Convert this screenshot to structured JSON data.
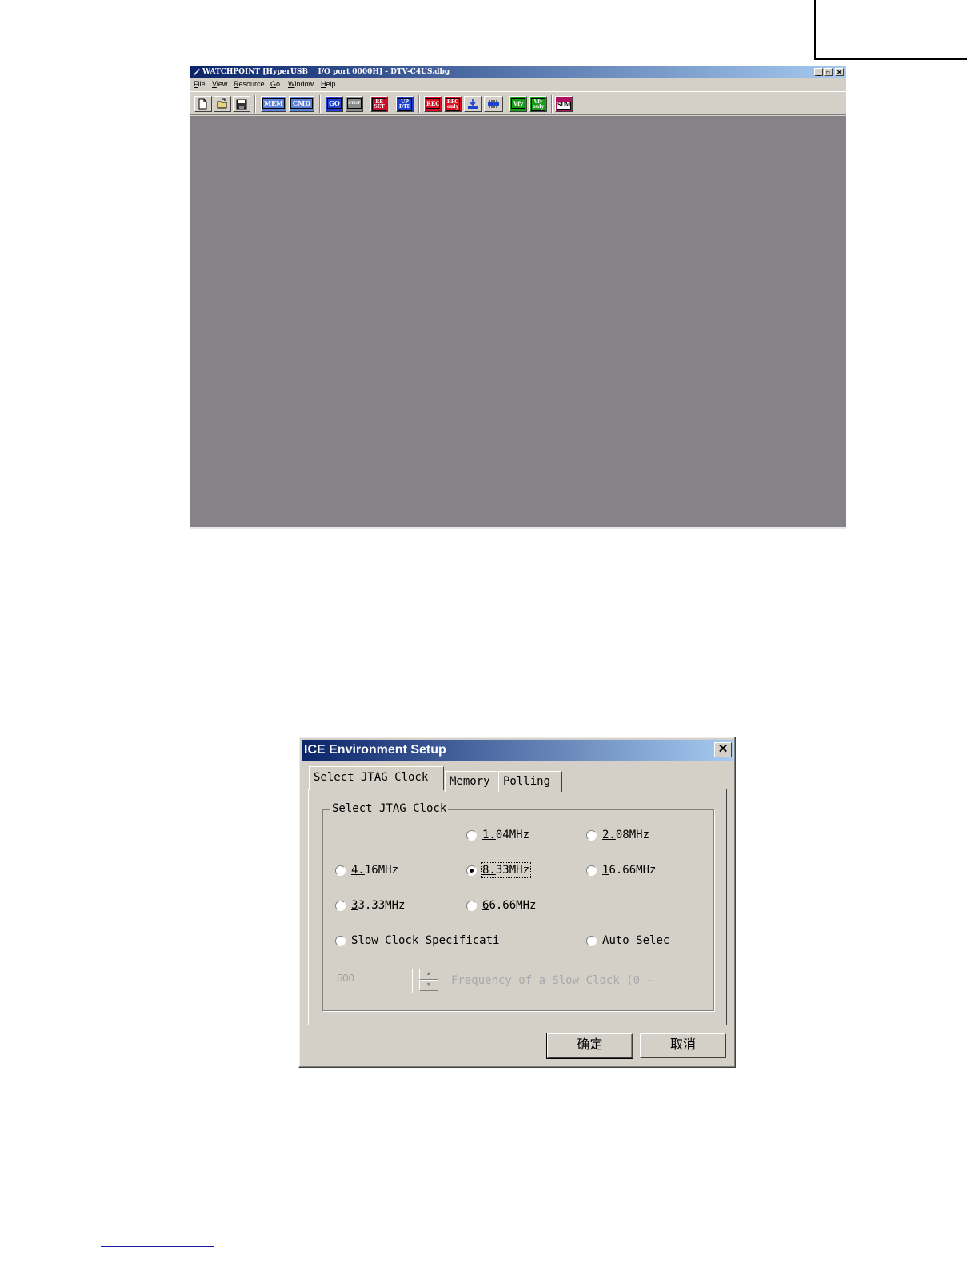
{
  "app": {
    "title": "WATCHPOINT [HyperUSB    I/O port 0000H] - DTV-C4US.dbg",
    "window_buttons": {
      "minimize": "_",
      "restore": "▫",
      "close": "✕"
    },
    "menu": [
      "File",
      "View",
      "Resource",
      "Go",
      "Window",
      "Help"
    ],
    "toolbar": {
      "mem": "MEM",
      "cmd": "CMD",
      "go": "GO",
      "stop": "STOP",
      "reset": "RE SET",
      "update": "UP DTE",
      "rec": "REC",
      "rec_only": "REC only",
      "vfy": "Vfy",
      "vfy_only": "Vfy only",
      "sum": "SUM"
    },
    "colors": {
      "titlebar": "#0a246a",
      "workspace": "#858387"
    }
  },
  "dialog": {
    "title": "ICE Environment Setup",
    "close": "✕",
    "tabs": [
      {
        "label": "Select JTAG Clock",
        "active": true
      },
      {
        "label": "Memory",
        "active": false
      },
      {
        "label": "Polling",
        "active": false
      }
    ],
    "group_title": "Select JTAG Clock",
    "radios": [
      {
        "label": "1.04MHz",
        "checked": false
      },
      {
        "label": "2.08MHz",
        "checked": false
      },
      {
        "label": "4.16MHz",
        "checked": false
      },
      {
        "label": "8.33MHz",
        "checked": true
      },
      {
        "label": "16.66MHz",
        "checked": false
      },
      {
        "label": "33.33MHz",
        "checked": false
      },
      {
        "label": "66.66MHz",
        "checked": false
      },
      {
        "label": "Slow Clock Specificati",
        "checked": false
      },
      {
        "label": "Auto Selec",
        "checked": false
      }
    ],
    "slow_clock_value": "500",
    "slow_clock_label": "Frequency of a Slow Clock (0 -",
    "spinner": {
      "up": "▲",
      "down": "▼"
    },
    "ok_label": "确定",
    "cancel_label": "取消"
  }
}
